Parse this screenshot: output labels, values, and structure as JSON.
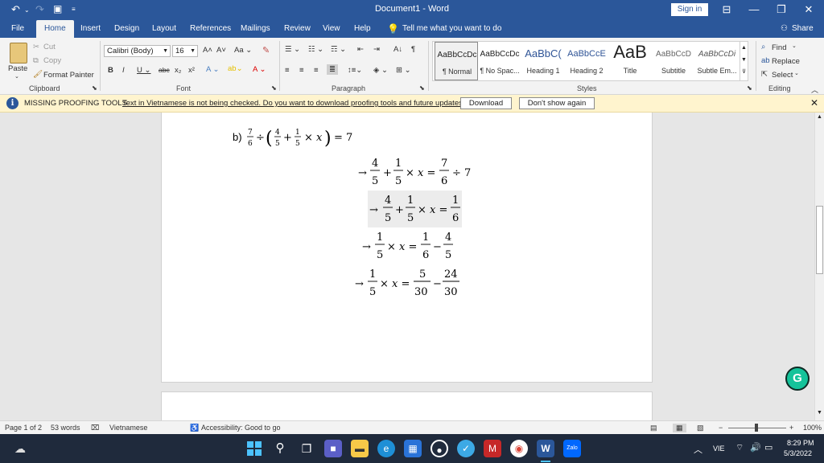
{
  "window": {
    "title": "Document1  -  Word",
    "sign_in": "Sign in"
  },
  "tabs": [
    "File",
    "Home",
    "Insert",
    "Design",
    "Layout",
    "References",
    "Mailings",
    "Review",
    "View",
    "Help"
  ],
  "tell_me": "Tell me what you want to do",
  "share": "Share",
  "clipboard": {
    "paste": "Paste",
    "cut": "Cut",
    "copy": "Copy",
    "format_painter": "Format Painter",
    "label": "Clipboard"
  },
  "font": {
    "name": "Calibri (Body)",
    "size": "16",
    "label": "Font"
  },
  "paragraph": {
    "label": "Paragraph"
  },
  "styles": {
    "label": "Styles",
    "items": [
      {
        "sample": "AaBbCcDc",
        "name": "¶ Normal"
      },
      {
        "sample": "AaBbCcDc",
        "name": "¶ No Spac..."
      },
      {
        "sample": "AaBbC(",
        "name": "Heading 1"
      },
      {
        "sample": "AaBbCcE",
        "name": "Heading 2"
      },
      {
        "sample": "AaB",
        "name": "Title"
      },
      {
        "sample": "AaBbCcD",
        "name": "Subtitle"
      },
      {
        "sample": "AaBbCcDi",
        "name": "Subtle Em..."
      }
    ]
  },
  "editing": {
    "find": "Find",
    "replace": "Replace",
    "select": "Select",
    "label": "Editing"
  },
  "message_bar": {
    "title": "MISSING PROOFING TOOLS",
    "text": "Text in Vietnamese is not being checked. Do you want to download proofing tools and future updates?",
    "download": "Download",
    "dont_show": "Don't show again"
  },
  "document": {
    "problem_label": "b)"
  },
  "status": {
    "page": "Page 1 of 2",
    "words": "53 words",
    "language": "Vietnamese",
    "accessibility": "Accessibility: Good to go",
    "zoom": "100%"
  },
  "taskbar": {
    "time": "8:29 PM",
    "date": "5/3/2022",
    "lang": "VIE"
  },
  "colors": {
    "word_blue": "#2b579a",
    "message_bar": "#fff4ce",
    "taskbar": "#1f2a3c",
    "grammarly": "#15c39a"
  }
}
